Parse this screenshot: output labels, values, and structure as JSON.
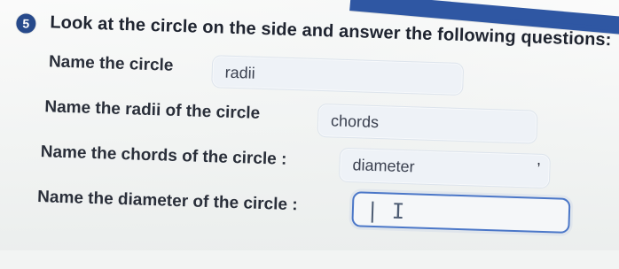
{
  "question": {
    "number": "5",
    "prompt": "Look at the circle on the side and answer the following questions:"
  },
  "rows": [
    {
      "label": "Name the circle",
      "answer": "radii"
    },
    {
      "label": "Name the radii of the circle",
      "answer": "chords"
    },
    {
      "label": "Name the chords of the circle :",
      "answer": "diameter"
    },
    {
      "label": "Name the diameter of the circle :",
      "answer": "| I"
    }
  ],
  "extras": {
    "comma": ","
  }
}
